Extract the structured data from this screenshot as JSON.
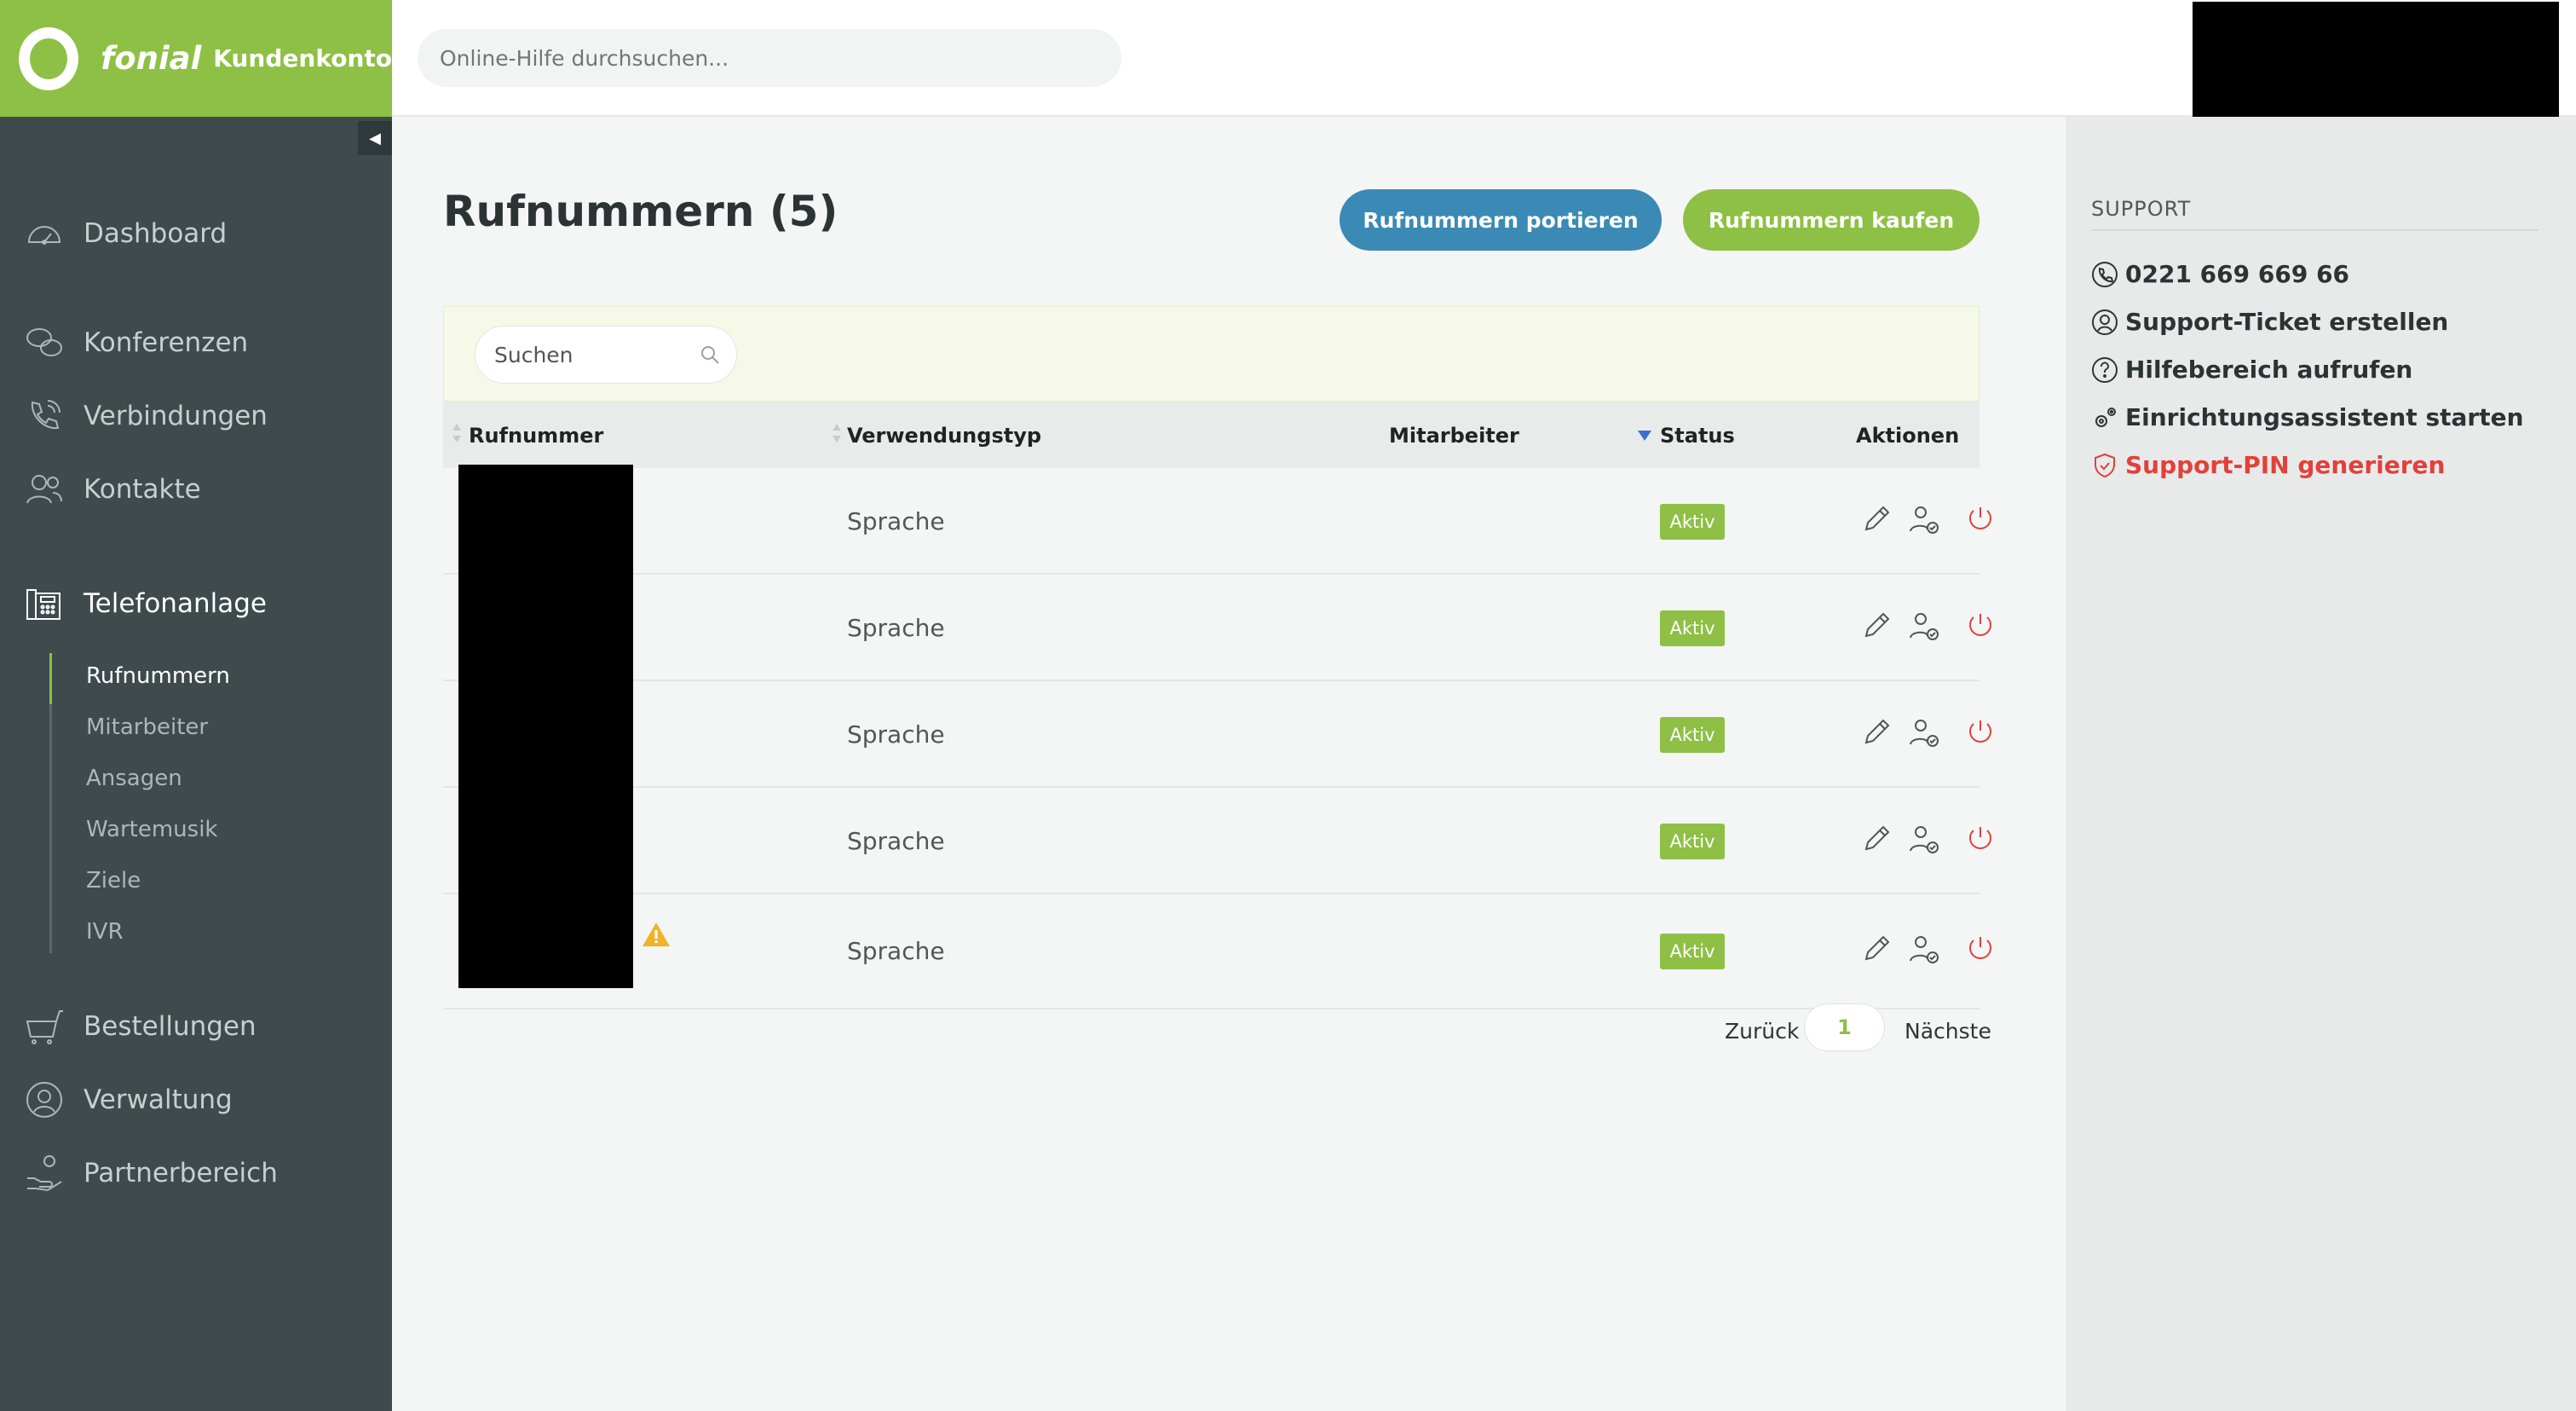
{
  "brand": {
    "name": "fonial",
    "subtitle": "Kundenkonto"
  },
  "topbar": {
    "search_placeholder": "Online-Hilfe durchsuchen..."
  },
  "sidebar": {
    "collapse_glyph": "◀",
    "items": [
      {
        "label": "Dashboard",
        "icon": "speedometer-icon"
      },
      {
        "label": "Konferenzen",
        "icon": "chat-bubbles-icon"
      },
      {
        "label": "Verbindungen",
        "icon": "phone-call-icon"
      },
      {
        "label": "Kontakte",
        "icon": "contacts-icon"
      },
      {
        "label": "Telefonanlage",
        "icon": "phone-system-icon"
      },
      {
        "label": "Bestellungen",
        "icon": "cart-icon"
      },
      {
        "label": "Verwaltung",
        "icon": "user-circle-icon"
      },
      {
        "label": "Partnerbereich",
        "icon": "partner-icon"
      }
    ],
    "subitems": [
      {
        "label": "Rufnummern"
      },
      {
        "label": "Mitarbeiter"
      },
      {
        "label": "Ansagen"
      },
      {
        "label": "Wartemusik"
      },
      {
        "label": "Ziele"
      },
      {
        "label": "IVR"
      }
    ]
  },
  "main": {
    "title": "Rufnummern (5)",
    "btn_port": "Rufnummern portieren",
    "btn_buy": "Rufnummern kaufen",
    "table_search_placeholder": "Suchen",
    "columns": {
      "number": "Rufnummer",
      "type": "Verwendungstyp",
      "employee": "Mitarbeiter",
      "status": "Status",
      "actions": "Aktionen"
    },
    "rows": [
      {
        "type": "Sprache",
        "status": "Aktiv"
      },
      {
        "type": "Sprache",
        "status": "Aktiv"
      },
      {
        "type": "Sprache",
        "status": "Aktiv"
      },
      {
        "type": "Sprache",
        "status": "Aktiv"
      },
      {
        "type": "Sprache",
        "status": "Aktiv"
      }
    ],
    "pager": {
      "prev": "Zurück",
      "page": "1",
      "next": "Nächste"
    }
  },
  "support": {
    "title": "SUPPORT",
    "phone": "0221 669 669 66",
    "ticket": "Support-Ticket erstellen",
    "help": "Hilfebereich aufrufen",
    "assistant": "Einrichtungsassistent starten",
    "pin": "Support-PIN generieren"
  },
  "colors": {
    "brand_green": "#8dc044",
    "sidebar": "#3e4a4c",
    "button_blue": "#3b8ab5",
    "alert_red": "#e2403a"
  }
}
